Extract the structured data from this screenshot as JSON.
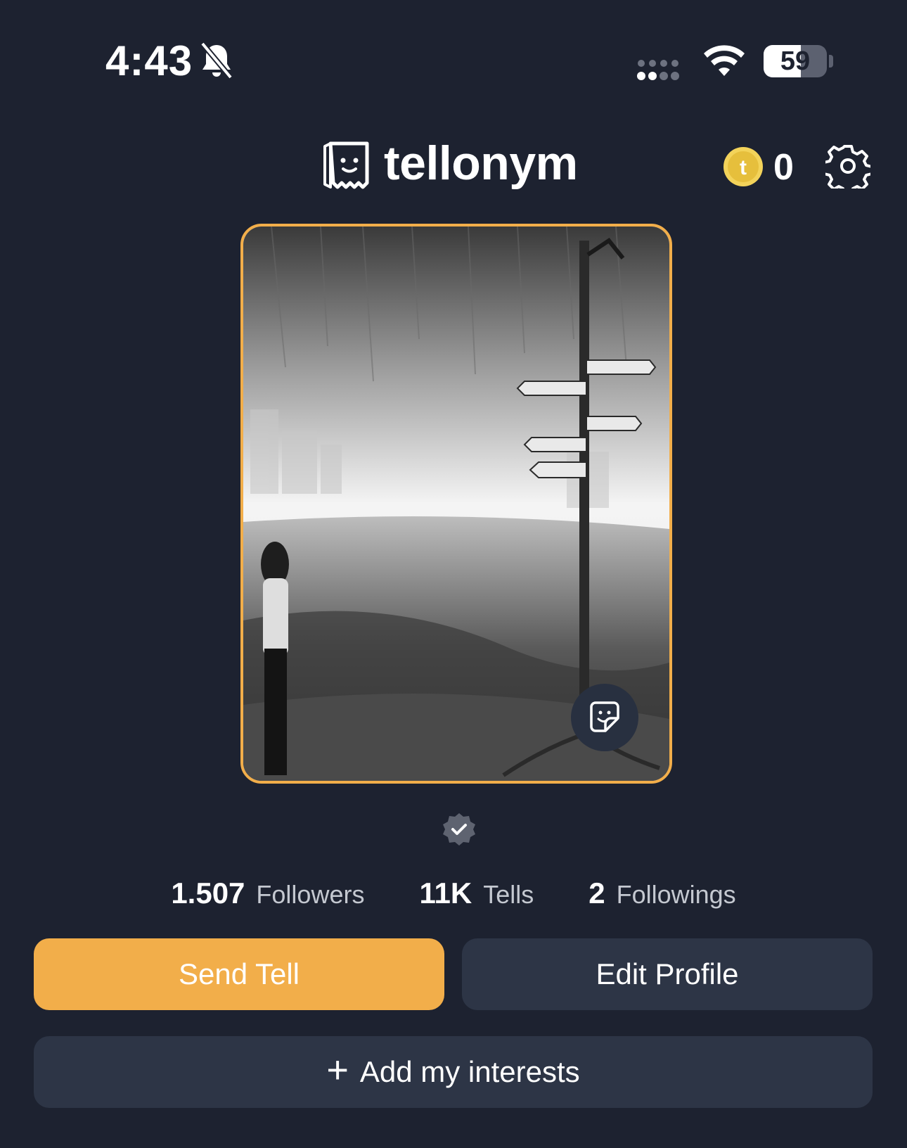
{
  "status_bar": {
    "time": "4:43",
    "battery_level": 59,
    "battery_label": "59",
    "icons": [
      "bell-slash-icon",
      "signal-icon",
      "wifi-icon",
      "battery-icon"
    ]
  },
  "header": {
    "logo_text": "tellonym",
    "coin_count": "0",
    "icons": [
      "tellonym-logo-icon",
      "coin-icon",
      "gear-icon"
    ]
  },
  "profile": {
    "image_description_icon": "sticker-icon",
    "verified_icon": "verified-badge-icon"
  },
  "stats": {
    "followers_value": "1.507",
    "followers_label": "Followers",
    "tells_value": "11K",
    "tells_label": "Tells",
    "followings_value": "2",
    "followings_label": "Followings"
  },
  "actions": {
    "send_tell": "Send Tell",
    "edit_profile": "Edit Profile",
    "add_interests": "Add my interests"
  },
  "colors": {
    "background": "#1d2230",
    "accent": "#f2ae4a",
    "secondary_button": "#2d3546",
    "coin": "#f3d35a"
  }
}
